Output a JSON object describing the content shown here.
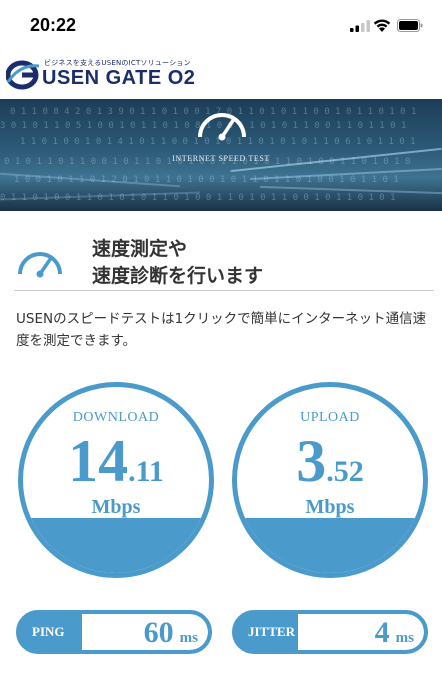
{
  "status_bar": {
    "time": "20:22"
  },
  "brand": {
    "tagline": "ビジネスを支えるUSENのICTソリューション",
    "name": "USEN GATE O2"
  },
  "hero": {
    "title": "INTERNET SPEED TEST"
  },
  "heading": {
    "line1": "速度測定や",
    "line2": "速度診断を行います"
  },
  "description": "USENのスピードテストは1クリックで簡単にインターネット通信速度を測定できます。",
  "download": {
    "label": "DOWNLOAD",
    "int": "14",
    "frac": "11",
    "unit": "Mbps"
  },
  "upload": {
    "label": "UPLOAD",
    "int": "3",
    "frac": "52",
    "unit": "Mbps"
  },
  "ping": {
    "label": "PING",
    "value": "60",
    "unit": "ms"
  },
  "jitter": {
    "label": "JITTER",
    "value": "4",
    "unit": "ms"
  },
  "colors": {
    "accent": "#4a9acb",
    "brand": "#1b2d6b"
  }
}
